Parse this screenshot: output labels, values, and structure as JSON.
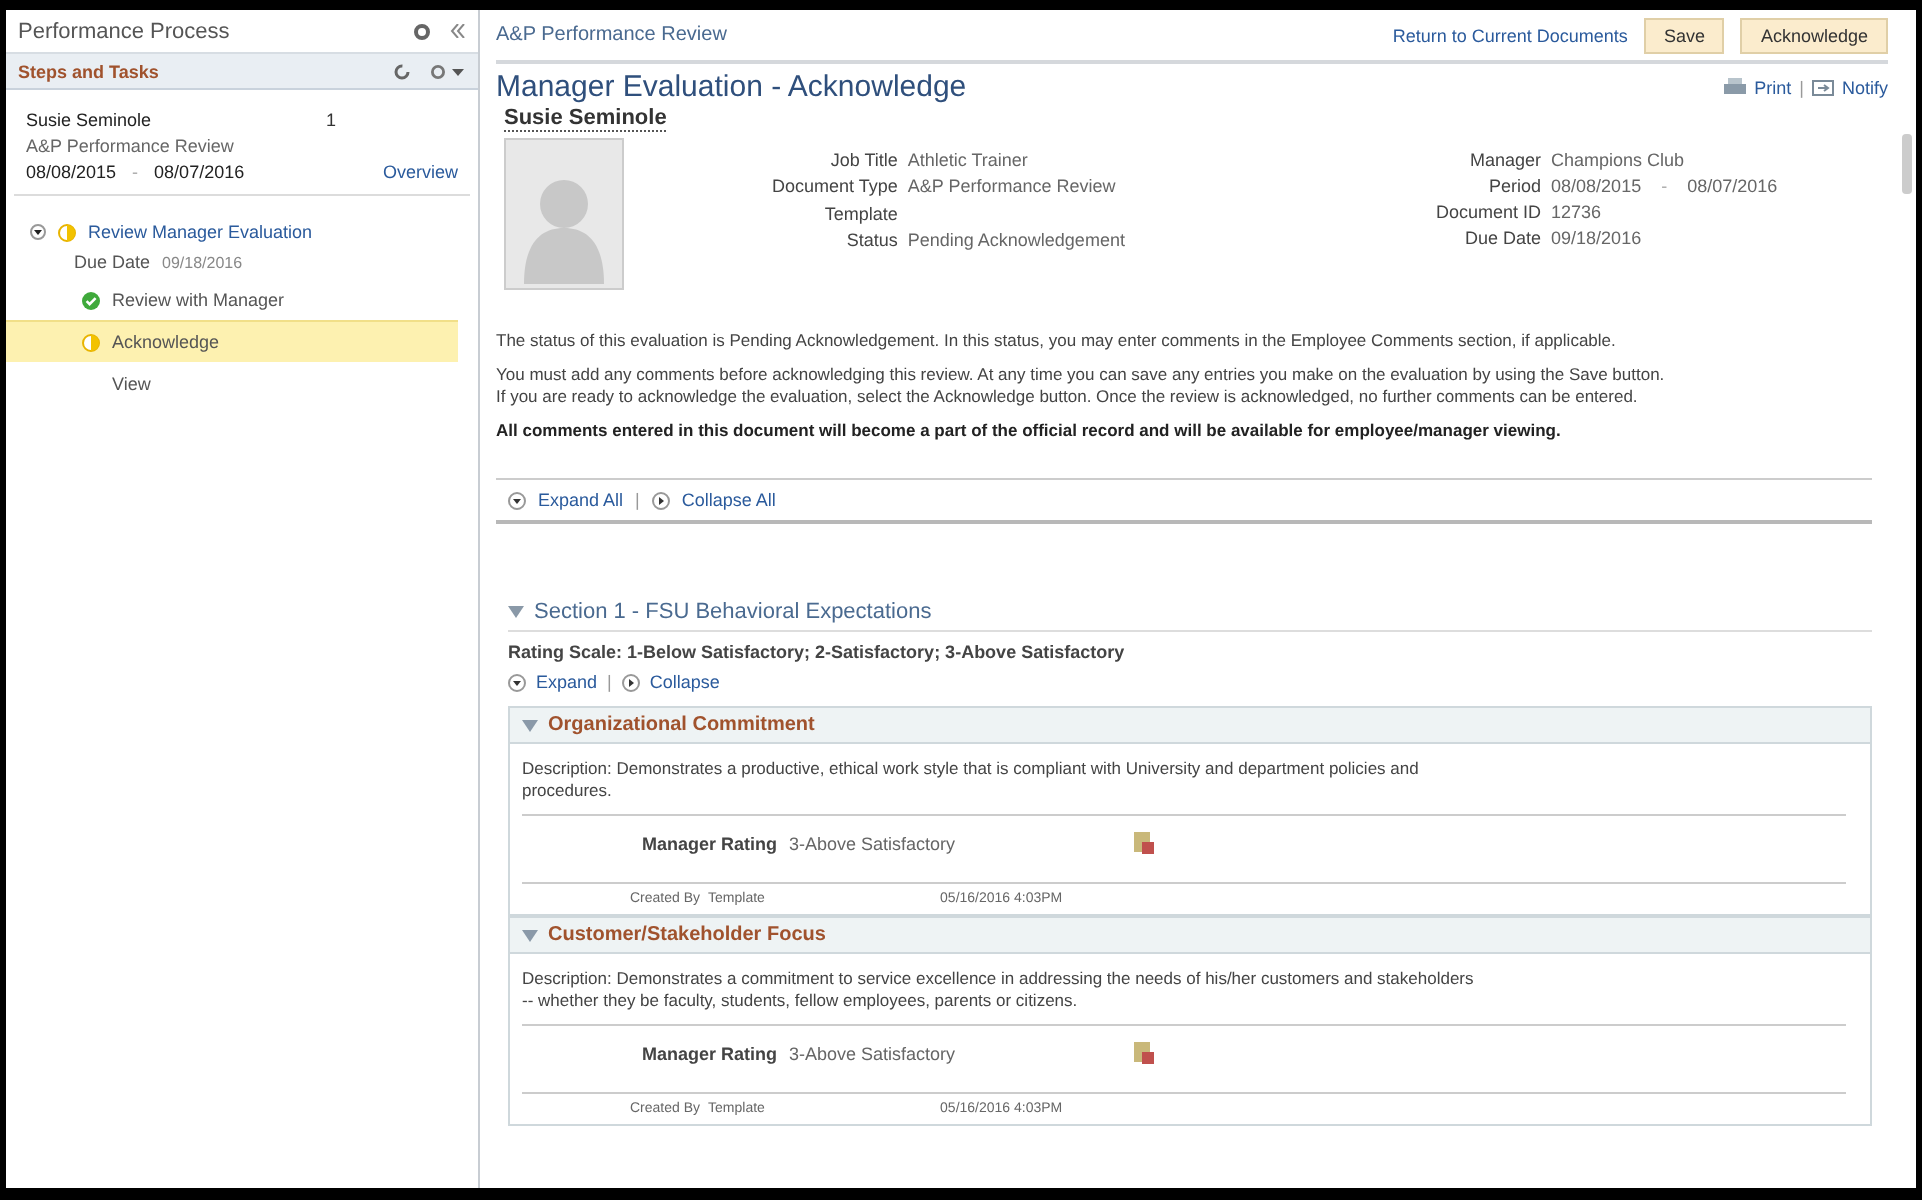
{
  "sidebar": {
    "title": "Performance Process",
    "panel_title": "Steps and Tasks",
    "employee": {
      "name": "Susie Seminole",
      "count": "1",
      "document": "A&P Performance Review",
      "start": "08/08/2015",
      "separator": "-",
      "end": "08/07/2016",
      "link": "Overview"
    },
    "steps": [
      {
        "label": "Review Manager Evaluation",
        "kind": "in_progress",
        "expanded": true,
        "selected": false,
        "due_label": "Due Date",
        "due_value": "09/18/2016",
        "children": [
          {
            "label": "Review with Manager",
            "kind": "complete",
            "selected": false
          },
          {
            "label": "Acknowledge",
            "kind": "in_progress",
            "selected": true
          },
          {
            "label": "View",
            "kind": "plain",
            "selected": false
          }
        ]
      }
    ]
  },
  "header": {
    "breadcrumb": "A&P Performance Review",
    "link": "Return to Current Documents",
    "buttons": [
      "Save",
      "Acknowledge"
    ]
  },
  "title": "Manager Evaluation - Acknowledge",
  "actions": {
    "print": "Print",
    "separator": "|",
    "notify": "Notify"
  },
  "employee_name": "Susie Seminole",
  "fields_left": [
    {
      "label": "Job Title",
      "value": "Athletic Trainer"
    },
    {
      "label": "Document Type",
      "value": "A&P Performance Review"
    },
    {
      "label": "Template"
    },
    {
      "label": "Status",
      "value": "Pending Acknowledgement"
    }
  ],
  "fields_right": [
    {
      "label": "Manager",
      "value": "Champions Club"
    },
    {
      "label": "Period",
      "value": "08/08/2015",
      "separator": "-",
      "value_end": "08/07/2016"
    },
    {
      "label": "Document ID",
      "value": "12736"
    },
    {
      "label": "Due Date",
      "value": "09/18/2016"
    }
  ],
  "paragraphs": [
    {
      "bold": false,
      "lines": [
        "The status of this evaluation is Pending Acknowledgement. In this status, you may enter comments in the Employee Comments section, if applicable."
      ]
    },
    {
      "bold": false,
      "lines": [
        "You must add any comments before acknowledging this review. At any time you can save any entries you make on the evaluation by using the Save button.",
        "If you are ready to acknowledge the evaluation, select the Acknowledge button. Once the review is acknowledged, no further comments can be entered."
      ]
    },
    {
      "bold": true,
      "lines": [
        "All comments entered in this document will become a part of the official record and will be available for employee/manager viewing."
      ]
    }
  ],
  "toggle_all": {
    "expand": "Expand All",
    "separator": "|",
    "collapse": "Collapse All"
  },
  "section": {
    "title": "Section 1 - FSU Behavioral Expectations",
    "expanded": true,
    "rating_scale": "Rating Scale: 1-Below Satisfactory; 2-Satisfactory; 3-Above Satisfactory",
    "toggles": {
      "expand": "Expand",
      "separator": "|",
      "collapse": "Collapse"
    },
    "items": [
      {
        "title": "Organizational Commitment",
        "expanded": true,
        "description": [
          "Description: Demonstrates a productive, ethical work style that is compliant with University and department policies and",
          "procedures."
        ],
        "rating_label": "Manager Rating",
        "rating_value": "3-Above Satisfactory",
        "created_label": "Created By",
        "created_value": "Template",
        "timestamp": "05/16/2016  4:03PM"
      },
      {
        "title": "Customer/Stakeholder Focus",
        "expanded": true,
        "description": [
          "Description: Demonstrates a commitment to service excellence in addressing the needs of his/her customers and stakeholders",
          "-- whether they be faculty, students, fellow employees, parents or citizens."
        ],
        "rating_label": "Manager Rating",
        "rating_value": "3-Above Satisfactory",
        "created_label": "Created By",
        "created_value": "Template",
        "timestamp": "05/16/2016  4:03PM"
      }
    ]
  }
}
